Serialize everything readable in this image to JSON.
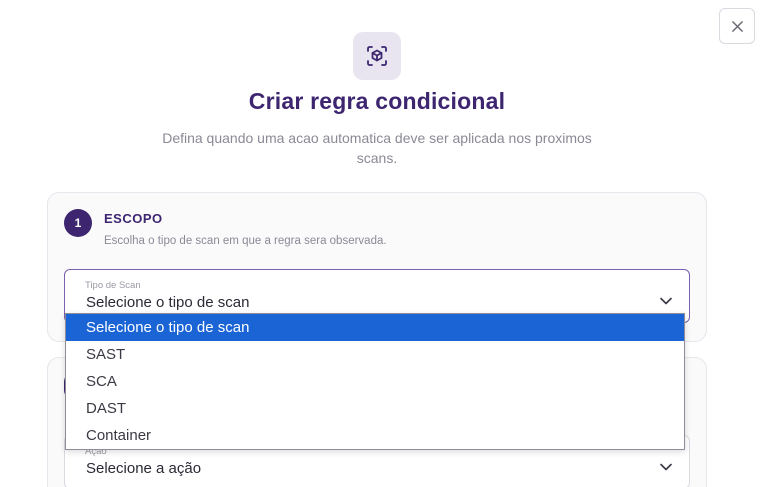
{
  "dialog": {
    "title": "Criar regra condicional",
    "subtitle": "Defina quando uma acao automatica deve ser aplicada nos proximos scans.",
    "close_icon": "close-icon",
    "hero_icon": "cube-scan-icon"
  },
  "step1": {
    "number": "1",
    "title": "ESCOPO",
    "description": "Escolha o tipo de scan em que a regra sera observada.",
    "field": {
      "label": "Tipo de Scan",
      "value": "Selecione o tipo de scan"
    }
  },
  "dropdown": {
    "options": [
      "Selecione o tipo de scan",
      "SAST",
      "SCA",
      "DAST",
      "Container"
    ],
    "selected_index": 0
  },
  "step2": {
    "field": {
      "label": "Ação",
      "value": "Selecione a ação"
    }
  },
  "colors": {
    "accent": "#3d2570",
    "highlight": "#1a64d6",
    "focus_border": "#7b5fb0"
  }
}
